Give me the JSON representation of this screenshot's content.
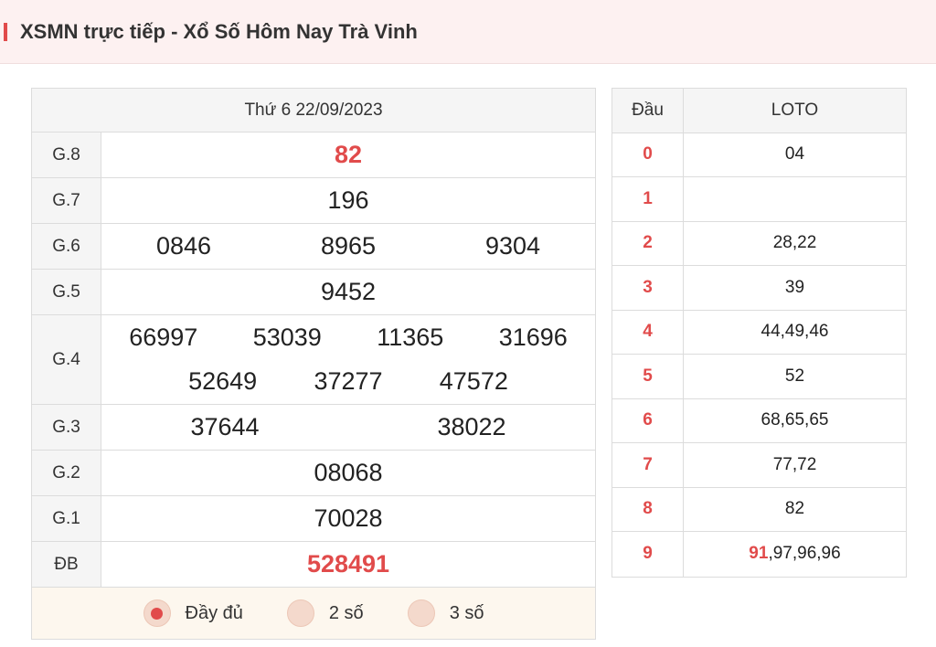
{
  "header": {
    "title": "XSMN trực tiếp - Xổ Số Hôm Nay Trà Vinh"
  },
  "results": {
    "date": "Thứ 6 22/09/2023",
    "prizes": {
      "g8": {
        "label": "G.8",
        "numbers": [
          "82"
        ]
      },
      "g7": {
        "label": "G.7",
        "numbers": [
          "196"
        ]
      },
      "g6": {
        "label": "G.6",
        "numbers": [
          "0846",
          "8965",
          "9304"
        ]
      },
      "g5": {
        "label": "G.5",
        "numbers": [
          "9452"
        ]
      },
      "g4": {
        "label": "G.4",
        "numbers": [
          "66997",
          "53039",
          "11365",
          "31696",
          "52649",
          "37277",
          "47572"
        ]
      },
      "g3": {
        "label": "G.3",
        "numbers": [
          "37644",
          "38022"
        ]
      },
      "g2": {
        "label": "G.2",
        "numbers": [
          "08068"
        ]
      },
      "g1": {
        "label": "G.1",
        "numbers": [
          "70028"
        ]
      },
      "db": {
        "label": "ĐB",
        "numbers": [
          "528491"
        ]
      }
    },
    "options": [
      {
        "label": "Đầy đủ",
        "checked": true
      },
      {
        "label": "2 số",
        "checked": false
      },
      {
        "label": "3 số",
        "checked": false
      }
    ]
  },
  "loto": {
    "head_label": "Đầu",
    "value_label": "LOTO",
    "rows": [
      {
        "dau": "0",
        "highlight": "",
        "values": "04"
      },
      {
        "dau": "1",
        "highlight": "",
        "values": ""
      },
      {
        "dau": "2",
        "highlight": "",
        "values": "28,22"
      },
      {
        "dau": "3",
        "highlight": "",
        "values": "39"
      },
      {
        "dau": "4",
        "highlight": "",
        "values": "44,49,46"
      },
      {
        "dau": "5",
        "highlight": "",
        "values": "52"
      },
      {
        "dau": "6",
        "highlight": "",
        "values": "68,65,65"
      },
      {
        "dau": "7",
        "highlight": "",
        "values": "77,72"
      },
      {
        "dau": "8",
        "highlight": "",
        "values": "82"
      },
      {
        "dau": "9",
        "highlight": "91",
        "values": ",97,96,96"
      }
    ]
  },
  "colors": {
    "accent": "#e14b4b",
    "header_bg": "#fdf1f1",
    "options_bg": "#fdf7ee"
  }
}
